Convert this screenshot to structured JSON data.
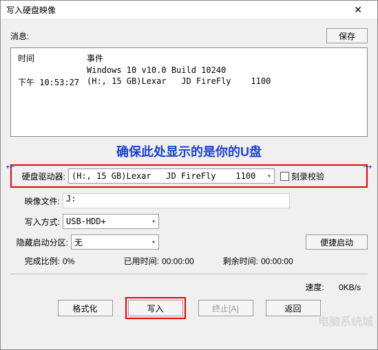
{
  "window": {
    "title": "写入硬盘映像",
    "close": "✕"
  },
  "info": {
    "label": "消息:",
    "save": "保存"
  },
  "log": {
    "time_header": "时间",
    "event_header": "事件",
    "line1": "Windows 10 v10.0 Build 10240",
    "time2": "下午 10:53:27",
    "line2": "(H:, 15 GB)Lexar   JD FireFly    1100"
  },
  "annotation": "确保此处显示的是你的U盘",
  "arrows": {
    "left": "←",
    "right": "→"
  },
  "drive": {
    "label": "硬盘驱动器:",
    "value": "(H:, 15 GB)Lexar   JD FireFly    1100",
    "verify": "刻录校验"
  },
  "image": {
    "label": "映像文件:",
    "value": "J:"
  },
  "method": {
    "label": "写入方式:",
    "value": "USB-HDD+"
  },
  "hidden": {
    "label": "隐藏启动分区:",
    "value": "无",
    "boot_btn": "便捷启动"
  },
  "progress": {
    "done_label": "完成比例:",
    "done_val": "0%",
    "elapsed_label": "已用时间:",
    "elapsed_val": "00:00:00",
    "remain_label": "剩余时间:",
    "remain_val": "00:00:00"
  },
  "speed": {
    "label": "速度:",
    "value": "0KB/s"
  },
  "actions": {
    "format": "格式化",
    "write": "写入",
    "stop": "终止[A]",
    "back": "返回"
  },
  "watermark": "电脑系统城"
}
